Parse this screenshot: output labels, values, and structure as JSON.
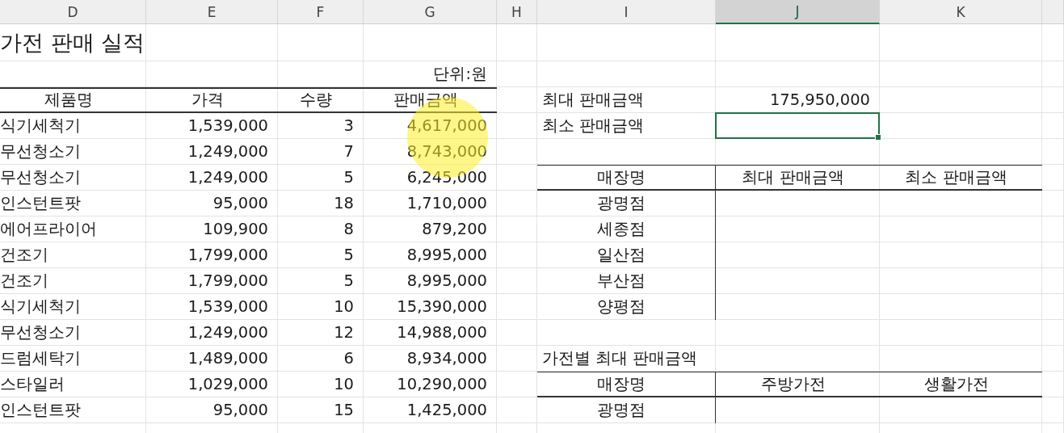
{
  "column_headers": [
    {
      "label": "D",
      "selected": false
    },
    {
      "label": "E",
      "selected": false
    },
    {
      "label": "F",
      "selected": false
    },
    {
      "label": "G",
      "selected": false
    },
    {
      "label": "H",
      "selected": false
    },
    {
      "label": "I",
      "selected": false
    },
    {
      "label": "J",
      "selected": true
    },
    {
      "label": "K",
      "selected": false
    }
  ],
  "title": "가전 판매 실적",
  "unit": "단위:원",
  "sales_table": {
    "columns": [
      "제품명",
      "가격",
      "수량",
      "판매금액"
    ],
    "rows": [
      [
        "식기세척기",
        "1,539,000",
        "3",
        "4,617,000"
      ],
      [
        "무선청소기",
        "1,249,000",
        "7",
        "8,743,000"
      ],
      [
        "무선청소기",
        "1,249,000",
        "5",
        "6,245,000"
      ],
      [
        "인스턴트팟",
        "95,000",
        "18",
        "1,710,000"
      ],
      [
        "에어프라이어",
        "109,900",
        "8",
        "879,200"
      ],
      [
        "건조기",
        "1,799,000",
        "5",
        "8,995,000"
      ],
      [
        "건조기",
        "1,799,000",
        "5",
        "8,995,000"
      ],
      [
        "식기세척기",
        "1,539,000",
        "10",
        "15,390,000"
      ],
      [
        "무선청소기",
        "1,249,000",
        "12",
        "14,988,000"
      ],
      [
        "드럼세탁기",
        "1,489,000",
        "6",
        "8,934,000"
      ],
      [
        "스타일러",
        "1,029,000",
        "10",
        "10,290,000"
      ],
      [
        "인스턴트팟",
        "95,000",
        "15",
        "1,425,000"
      ]
    ]
  },
  "summary": [
    {
      "label": "최대 판매금액",
      "value": "175,950,000",
      "selected": false
    },
    {
      "label": "최소 판매금액",
      "selected": true
    }
  ],
  "store_table": {
    "columns": [
      "매장명",
      "최대 판매금액",
      "최소 판매금액"
    ],
    "rows": [
      "광명점",
      "세종점",
      "일산점",
      "부산점",
      "양평점"
    ]
  },
  "category_table": {
    "title": "가전별 최대 판매금액",
    "columns": [
      "매장명",
      "주방가전",
      "생활가전"
    ],
    "rows": [
      "광명점"
    ]
  }
}
